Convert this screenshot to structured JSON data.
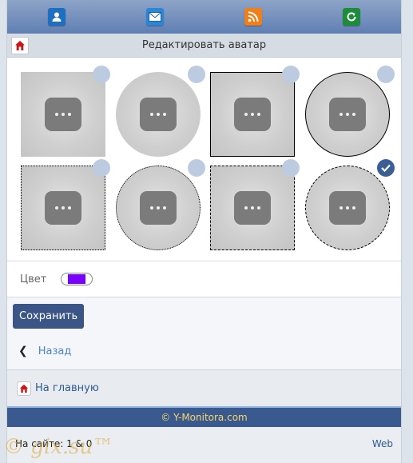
{
  "topbar": {
    "icons": [
      "user-icon",
      "mail-icon",
      "rss-icon",
      "refresh-icon"
    ]
  },
  "header": {
    "title": "Редактировать аватар"
  },
  "avatars": [
    {
      "shape": "square",
      "border": "none",
      "selected": false
    },
    {
      "shape": "circle",
      "border": "none",
      "selected": false
    },
    {
      "shape": "square",
      "border": "solid",
      "selected": false
    },
    {
      "shape": "circle",
      "border": "solid",
      "selected": false
    },
    {
      "shape": "square",
      "border": "dotted",
      "selected": false
    },
    {
      "shape": "circle",
      "border": "dotted",
      "selected": false
    },
    {
      "shape": "square",
      "border": "dashed",
      "selected": false
    },
    {
      "shape": "circle",
      "border": "dashed",
      "selected": true
    }
  ],
  "color": {
    "label": "Цвет",
    "value": "#7a00ff"
  },
  "actions": {
    "save_label": "Сохранить",
    "back_label": "Назад",
    "home_label": "На главную"
  },
  "footer": {
    "copyright": "© Y-Monitora.com",
    "online": "На сайте: 1 & 0",
    "web": "Web"
  },
  "watermark": "© gix.su™",
  "colors": {
    "accent": "#3b5587",
    "topbar": "#6f8dbd",
    "link": "#4f84c4",
    "footer": "#3a5a8f",
    "footer_text": "#f5d66a"
  }
}
